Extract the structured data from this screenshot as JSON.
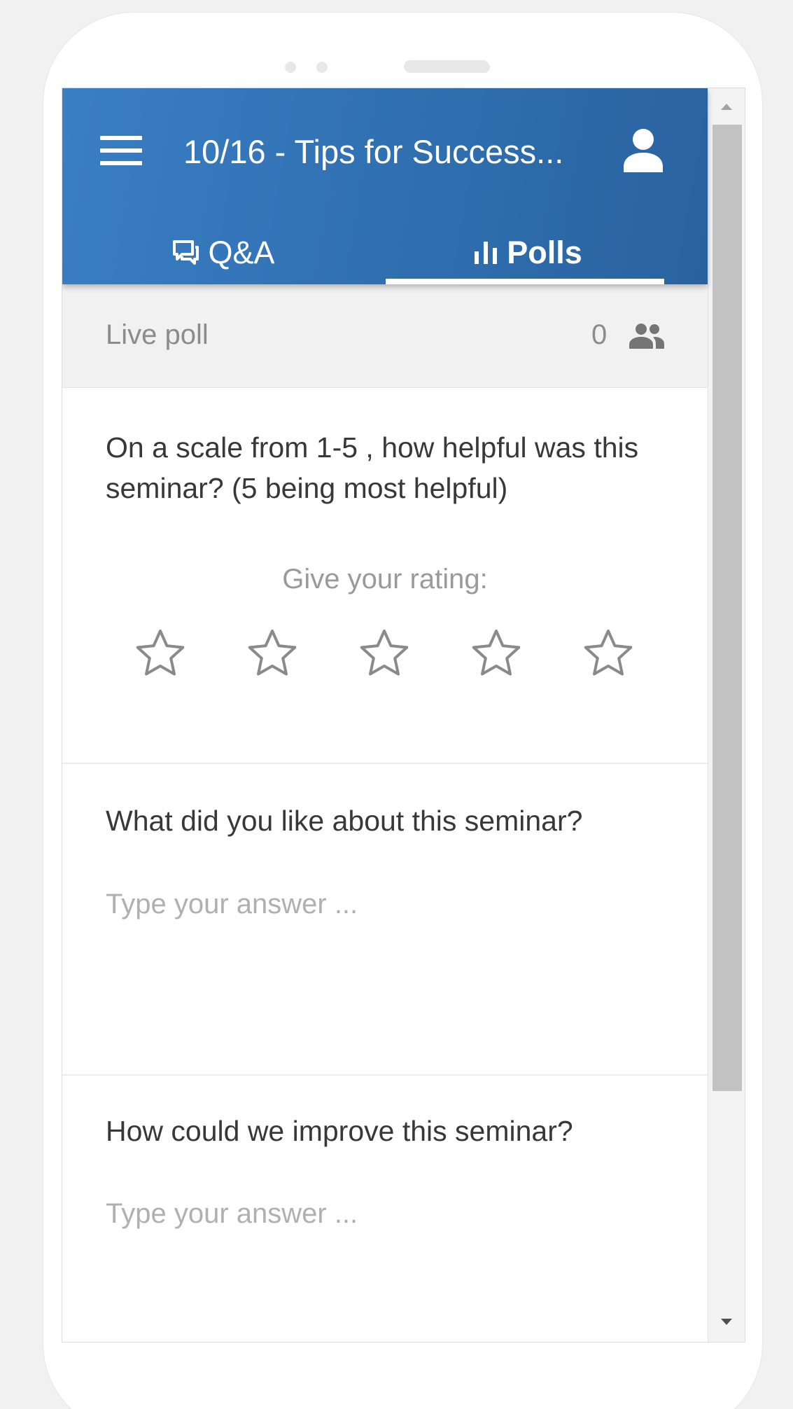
{
  "app": {
    "title": "10/16 - Tips for Success...",
    "menu_icon": "hamburger-menu-icon",
    "user_icon": "user-account-icon"
  },
  "tabs": [
    {
      "label": "Q&A",
      "icon": "chat-bubbles-icon",
      "active": false
    },
    {
      "label": "Polls",
      "icon": "bar-chart-icon",
      "active": true
    }
  ],
  "live_poll": {
    "label": "Live poll",
    "participant_count": "0",
    "icon": "people-icon"
  },
  "questions": [
    {
      "text": "On a scale from 1-5 , how helpful was this seminar? (5 being most helpful)",
      "type": "rating",
      "rating_prompt": "Give your rating:",
      "max_stars": 5,
      "selected_stars": 0
    },
    {
      "text": "What did you like about this seminar?",
      "type": "text",
      "placeholder": "Type your answer ..."
    },
    {
      "text": "How could we improve this seminar?",
      "type": "text",
      "placeholder": "Type your answer ..."
    }
  ],
  "colors": {
    "appbar": "#2f6fb0",
    "page_background": "#f1f1f1",
    "star_outline": "#8a8a8a"
  }
}
